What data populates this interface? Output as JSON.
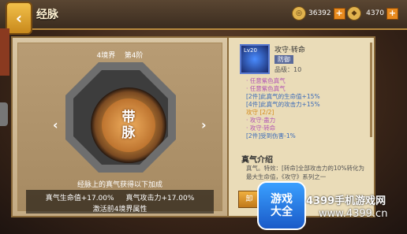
{
  "header": {
    "title": "经脉",
    "back_icon": "back-arrow-icon"
  },
  "resources": [
    {
      "icon": "coin-icon",
      "value": "36392"
    },
    {
      "icon": "ingot-icon",
      "value": "4370"
    }
  ],
  "meridian": {
    "realm": "4境界",
    "stage": "第4阶",
    "name_line1": "带",
    "name_line2": "脉",
    "description": "经脉上的真气获得以下加成",
    "stat1": "真气生命值+17.00%",
    "stat2": "真气攻击力+17.00%",
    "hint": "激活前4境界属性"
  },
  "item": {
    "level": "Lv20",
    "name": "攻守·转命",
    "type": "防御",
    "grade": "品级：10",
    "attributes": [
      {
        "text": "· 任意紫色真气",
        "color": "purple"
      },
      {
        "text": "· 任意紫色真气",
        "color": "purple"
      },
      {
        "text": "[2件]此真气的生命值+15%",
        "color": "blue"
      },
      {
        "text": "[4件]此真气的攻击力+15%",
        "color": "blue"
      },
      {
        "text": "攻守 [2/2]",
        "color": "orange"
      },
      {
        "text": "· 攻守·蛊力",
        "color": "purple"
      },
      {
        "text": "· 攻守·转命",
        "color": "purple"
      },
      {
        "text": "[2件]受到伤害-1%",
        "color": "blue"
      }
    ],
    "intro_title": "真气介绍",
    "intro_body": "真气。特效：[转命]全部攻击力的10%转化为最大生命值，《攻守》系列之一"
  },
  "unload_label": "卸",
  "watermark": {
    "logo_line1": "游戏",
    "logo_line2": "大全",
    "text": "4399手机游戏网",
    "url": "www.4399.cn"
  }
}
